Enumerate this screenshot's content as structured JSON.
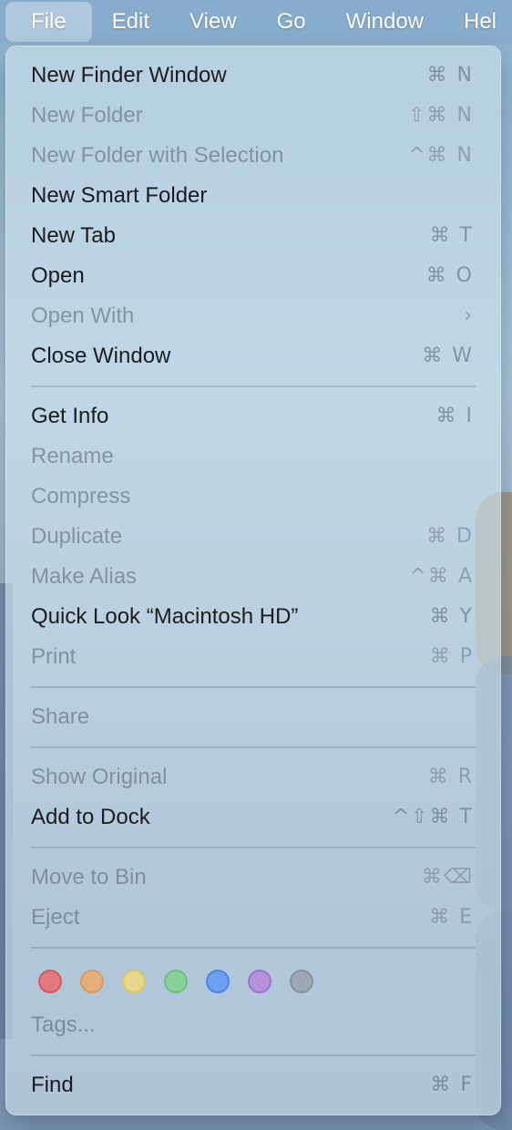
{
  "menubar": {
    "items": [
      "File",
      "Edit",
      "View",
      "Go",
      "Window",
      "Hel"
    ]
  },
  "menu": {
    "group1": [
      {
        "label": "New Finder Window",
        "shortcut": "⌘ N",
        "enabled": true
      },
      {
        "label": "New Folder",
        "shortcut": "⇧⌘ N",
        "enabled": false
      },
      {
        "label": "New Folder with Selection",
        "shortcut": "^⌘ N",
        "enabled": false
      },
      {
        "label": "New Smart Folder",
        "shortcut": "",
        "enabled": true
      },
      {
        "label": "New Tab",
        "shortcut": "⌘ T",
        "enabled": true
      },
      {
        "label": "Open",
        "shortcut": "⌘ O",
        "enabled": true
      },
      {
        "label": "Open With",
        "shortcut": "›",
        "enabled": false
      },
      {
        "label": "Close Window",
        "shortcut": "⌘ W",
        "enabled": true
      }
    ],
    "group2": [
      {
        "label": "Get Info",
        "shortcut": "⌘ I",
        "enabled": true
      },
      {
        "label": "Rename",
        "shortcut": "",
        "enabled": false
      },
      {
        "label": "Compress",
        "shortcut": "",
        "enabled": false
      },
      {
        "label": "Duplicate",
        "shortcut": "⌘ D",
        "enabled": false
      },
      {
        "label": "Make Alias",
        "shortcut": "^⌘ A",
        "enabled": false
      },
      {
        "label": "Quick Look “Macintosh HD”",
        "shortcut": "⌘ Y",
        "enabled": true
      },
      {
        "label": "Print",
        "shortcut": "⌘ P",
        "enabled": false
      }
    ],
    "group3": [
      {
        "label": "Share",
        "shortcut": "",
        "enabled": false
      }
    ],
    "group4": [
      {
        "label": "Show Original",
        "shortcut": "⌘ R",
        "enabled": false
      },
      {
        "label": "Add to Dock",
        "shortcut": "^⇧⌘ T",
        "enabled": true
      }
    ],
    "group5": [
      {
        "label": "Move to Bin",
        "shortcut": "⌘⌫",
        "enabled": false
      },
      {
        "label": "Eject",
        "shortcut": "⌘ E",
        "enabled": false
      }
    ],
    "tags": {
      "colors": [
        "#e07a7e",
        "#e6ae7a",
        "#e8d68a",
        "#88cf9a",
        "#6e9ff0",
        "#b592dc",
        "#9ea8b2"
      ],
      "label": "Tags..."
    },
    "group7": [
      {
        "label": "Find",
        "shortcut": "⌘ F",
        "enabled": true
      }
    ]
  }
}
